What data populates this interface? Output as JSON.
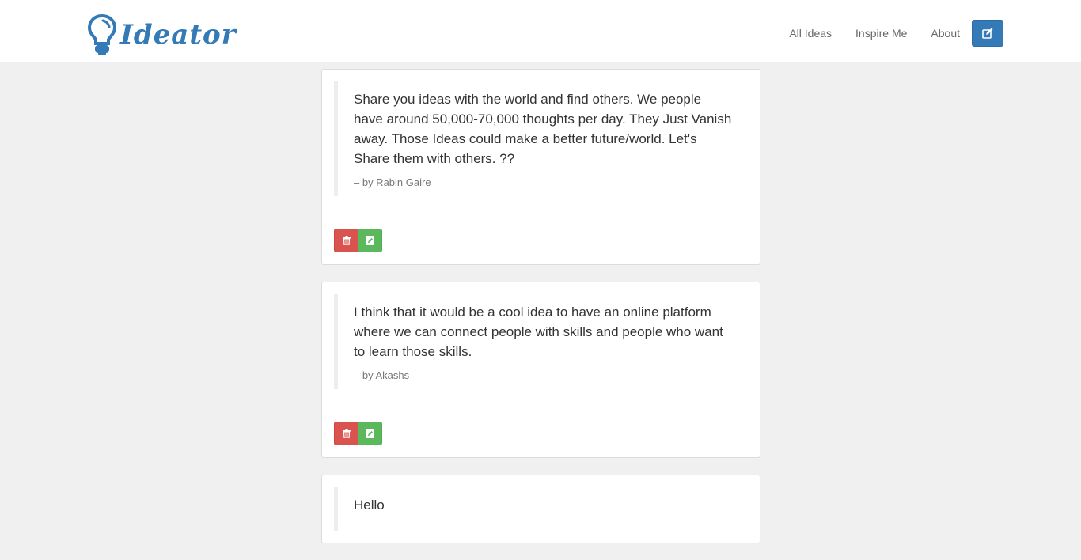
{
  "brand": {
    "name": "Ideator",
    "logo_icon": "lightbulb-icon"
  },
  "nav": {
    "links": [
      "All Ideas",
      "Inspire Me",
      "About"
    ],
    "new_idea_icon": "edit-icon"
  },
  "colors": {
    "primary": "#337ab7",
    "danger": "#d9534f",
    "success": "#5cb85c",
    "background": "#f0f0f0"
  },
  "ideas": [
    {
      "text": "Share you ideas with the world and find others. We people have around 50,000-70,000 thoughts per day. They Just Vanish away. Those Ideas could make a better future/world. Let's Share them with others. ??",
      "author": "– by Rabin Gaire"
    },
    {
      "text": "I think that it would be a cool idea to have an online platform where we can connect people with skills and people who want to learn those skills.",
      "author": "– by Akashs"
    },
    {
      "text": "Hello",
      "author": ""
    }
  ]
}
